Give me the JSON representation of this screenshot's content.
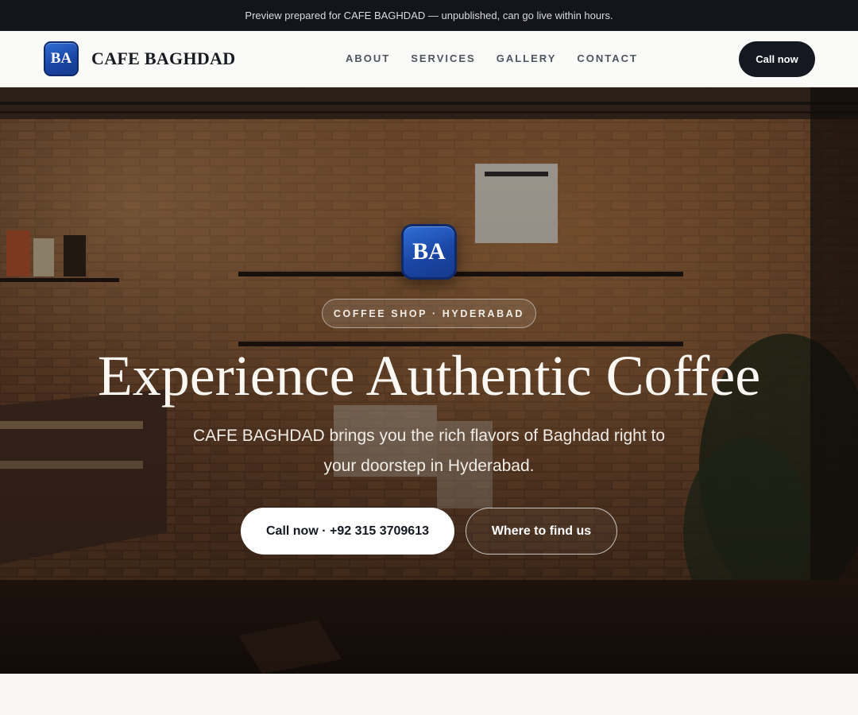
{
  "preview_banner": "Preview prepared for CAFE BAGHDAD — unpublished, can go live within hours.",
  "brand": {
    "logo_text": "BA",
    "name": "CAFE BAGHDAD",
    "logo_color": "#1b46a6"
  },
  "nav": {
    "links": [
      "ABOUT",
      "SERVICES",
      "GALLERY",
      "CONTACT"
    ],
    "cta_label": "Call now"
  },
  "hero": {
    "logo_text": "BA",
    "tagline": "COFFEE SHOP · HYDERABAD",
    "title": "Experience Authentic Coffee",
    "subtitle": "CAFE BAGHDAD brings you the rich flavors of Baghdad right to your doorstep in Hyderabad.",
    "primary_button": "Call now · +92 315 3709613",
    "secondary_button": "Where to find us"
  },
  "colors": {
    "dark": "#12151c",
    "accent": "#1b46a6",
    "light": "#f8f7f3"
  }
}
